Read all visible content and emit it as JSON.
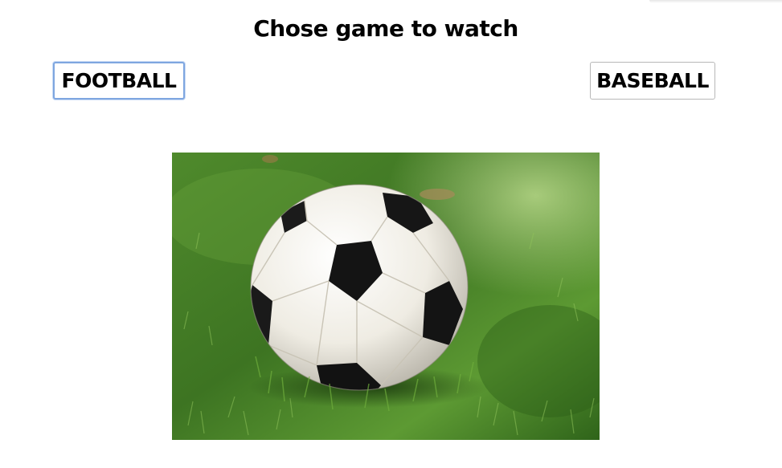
{
  "page": {
    "title": "Chose game to watch"
  },
  "buttons": {
    "football_label": "FOOTBALL",
    "baseball_label": "BASEBALL"
  },
  "image": {
    "alt": "Soccer ball on grass",
    "subject_icon": "soccer-ball",
    "grass_color": "#3f7a24",
    "grass_light_color": "#7fb24a",
    "ball_white": "#f3f1ea",
    "ball_black": "#141414"
  },
  "colors": {
    "focus_ring": "#7ea6e0",
    "button_border": "#b8b8b8",
    "text": "#000000",
    "background": "#ffffff"
  }
}
